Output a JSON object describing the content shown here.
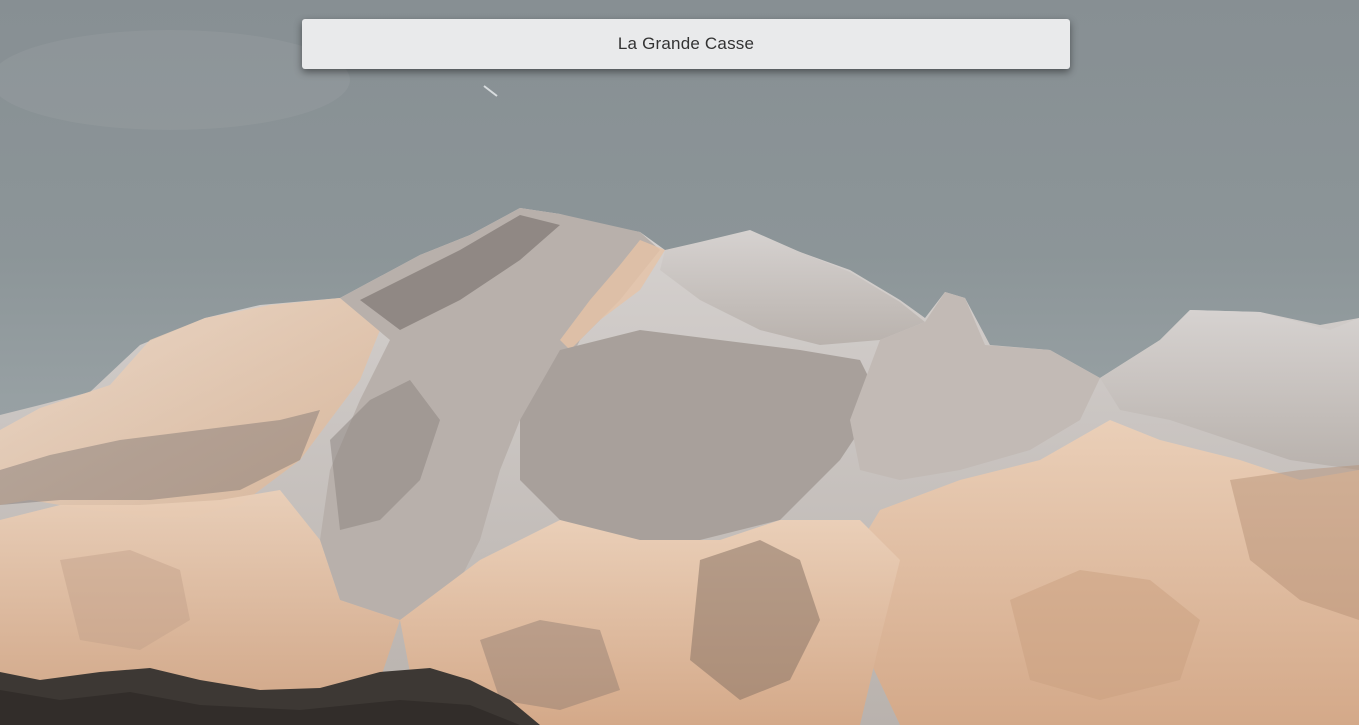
{
  "header": {
    "title": "La Grande Casse"
  },
  "colors": {
    "sky_top": "#878f93",
    "sky_bottom": "#a2aaad",
    "snow_lit": "#e8cbb3",
    "snow_shadow": "#c9c3c0",
    "rock": "#4a4643",
    "title_bar_bg": "#e9eaeb",
    "title_text": "#333333"
  }
}
